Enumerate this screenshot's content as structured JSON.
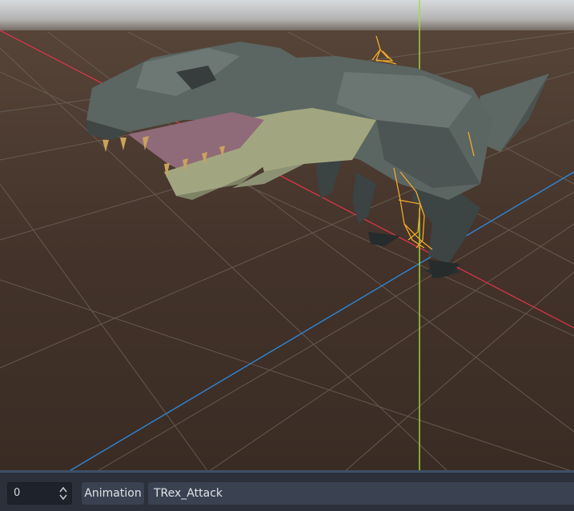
{
  "viewport": {
    "subject": "T-Rex 3D model with skeleton",
    "colors": {
      "sky_top": "#c8ccd2",
      "floor": "#3f3028",
      "grid": "#6c6157",
      "axis_x": "#e8334a",
      "axis_y": "#9ee23c",
      "axis_z": "#2e86d6",
      "bone": "#f2a92a",
      "dino_body": "#5b6561",
      "dino_dark": "#424b49",
      "dino_belly": "#a2a680",
      "mouth": "#8f6a78",
      "teeth": "#c9a25c"
    }
  },
  "bottom_bar": {
    "frame_value": "0",
    "animation_label": "Animation",
    "animation_name": "TRex_Attack",
    "spin_icon": "updown-arrows-icon"
  }
}
